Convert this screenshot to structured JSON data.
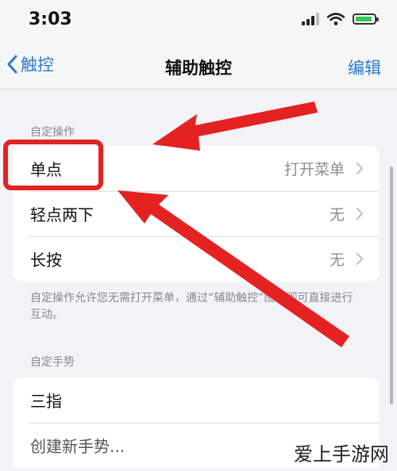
{
  "status_bar": {
    "time": "3:03"
  },
  "nav": {
    "back_label": "触控",
    "title": "辅助触控",
    "edit_label": "编辑"
  },
  "custom_actions": {
    "header": "自定操作",
    "items": [
      {
        "label": "单点",
        "value": "打开菜单"
      },
      {
        "label": "轻点两下",
        "value": "无"
      },
      {
        "label": "长按",
        "value": "无"
      }
    ],
    "footnote": "自定操作允许您无需打开菜单，通过“辅助触控”图标即可直接进行互动。"
  },
  "custom_gestures": {
    "header": "自定手势",
    "items": [
      {
        "label": "三指"
      },
      {
        "label": "创建新手势..."
      }
    ]
  },
  "annotation": {
    "color": "#e42222"
  },
  "accent_color": "#2a7bd6",
  "watermark": "爱上手游网"
}
